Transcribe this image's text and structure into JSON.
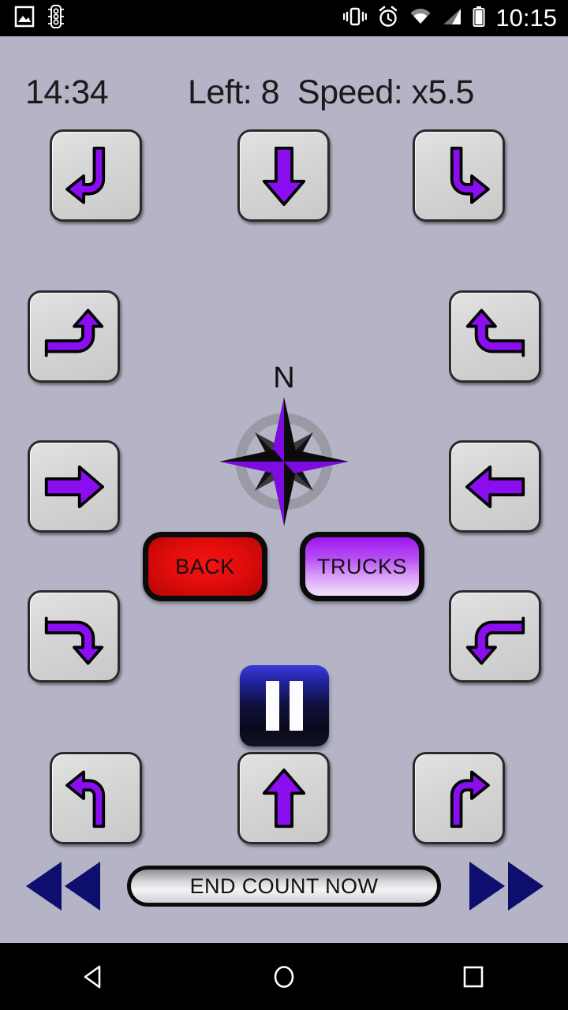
{
  "statusbar": {
    "time": "10:15",
    "icons": [
      {
        "name": "image-icon"
      },
      {
        "name": "traffic-light-icon"
      },
      {
        "name": "vibrate-icon"
      },
      {
        "name": "alarm-icon"
      },
      {
        "name": "wifi-icon"
      },
      {
        "name": "signal-icon"
      },
      {
        "name": "battery-icon"
      }
    ]
  },
  "header": {
    "elapsed_time": "14:34",
    "status": "Left: 8  Speed: x5.5",
    "left_label": "Left:",
    "left_value": "8",
    "speed_label": "Speed:",
    "speed_value": "x5.5"
  },
  "compass": {
    "north_label": "N"
  },
  "colors": {
    "background": "#b4b4c6",
    "arrow_purple": "#8a0ef0",
    "button_face": "#d6d6d6",
    "back_red": "#e20d0d",
    "trucks_purple": "#9d17f0",
    "pause_blue": "#2424a8",
    "seek_navy": "#0e0e6e"
  },
  "movement_buttons": [
    {
      "name": "turn-from-top-to-left",
      "icon": "arrow-top-to-left",
      "row": 1,
      "col": "left"
    },
    {
      "name": "straight-down",
      "icon": "arrow-down",
      "row": 1,
      "col": "center"
    },
    {
      "name": "turn-from-top-to-right",
      "icon": "arrow-top-to-right",
      "row": 1,
      "col": "right"
    },
    {
      "name": "turn-from-left-to-up",
      "icon": "arrow-left-to-up",
      "row": 2,
      "col": "left"
    },
    {
      "name": "turn-from-right-to-up",
      "icon": "arrow-right-to-up",
      "row": 2,
      "col": "right"
    },
    {
      "name": "straight-right",
      "icon": "arrow-right",
      "row": 3,
      "col": "left"
    },
    {
      "name": "straight-left",
      "icon": "arrow-left",
      "row": 3,
      "col": "right"
    },
    {
      "name": "turn-from-left-to-down",
      "icon": "arrow-left-to-down",
      "row": 4,
      "col": "left"
    },
    {
      "name": "turn-from-right-to-down",
      "icon": "arrow-right-to-down",
      "row": 4,
      "col": "right"
    },
    {
      "name": "turn-from-bottom-to-left",
      "icon": "arrow-bottom-to-left",
      "row": 5,
      "col": "left"
    },
    {
      "name": "straight-up",
      "icon": "arrow-up",
      "row": 5,
      "col": "center"
    },
    {
      "name": "turn-from-bottom-to-right",
      "icon": "arrow-bottom-to-right",
      "row": 5,
      "col": "right"
    }
  ],
  "controls": {
    "back_label": "BACK",
    "trucks_label": "TRUCKS",
    "pause_label": "pause-icon",
    "end_count_label": "END COUNT NOW",
    "rewind_label": "rewind-icon",
    "forward_label": "fast-forward-icon"
  },
  "navbar": {
    "back": "back-triangle-icon",
    "home": "home-circle-icon",
    "recents": "recents-square-icon"
  }
}
